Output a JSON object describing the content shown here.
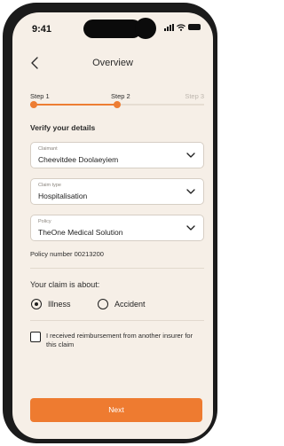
{
  "status_bar": {
    "time": "9:41",
    "icons": [
      "cellular-signal-icon",
      "wifi-icon",
      "battery-icon"
    ]
  },
  "nav": {
    "back_icon": "chevron-left-icon",
    "title": "Overview"
  },
  "progress": {
    "steps": [
      {
        "label": "Step 1",
        "state": "complete"
      },
      {
        "label": "Step 2",
        "state": "current"
      },
      {
        "label": "Step 3",
        "state": "upcoming"
      }
    ],
    "current_step": 2,
    "fraction": 0.5
  },
  "form": {
    "section_title": "Verify your details",
    "claimant": {
      "label": "Claimant",
      "value": "Cheevitdee Doolaeyiem"
    },
    "claim_type": {
      "label": "Claim type",
      "value": "Hospitalisation"
    },
    "policy": {
      "label": "Policy",
      "value": "TheOne Medical Solution"
    },
    "policy_number": "Policy number 00213200",
    "claim_about": {
      "question": "Your claim is about:",
      "options": [
        {
          "label": "Illness",
          "selected": true
        },
        {
          "label": "Accident",
          "selected": false
        }
      ]
    },
    "reimbursement_checkbox": {
      "label": "I received reimbursement from another insurer for this claim",
      "checked": false
    }
  },
  "actions": {
    "next_label": "Next"
  },
  "colors": {
    "accent": "#ee7b30",
    "background": "#f6efe7",
    "field_background": "#ffffff",
    "text": "#1e1e1e",
    "muted_text": "#bdb6ae"
  }
}
